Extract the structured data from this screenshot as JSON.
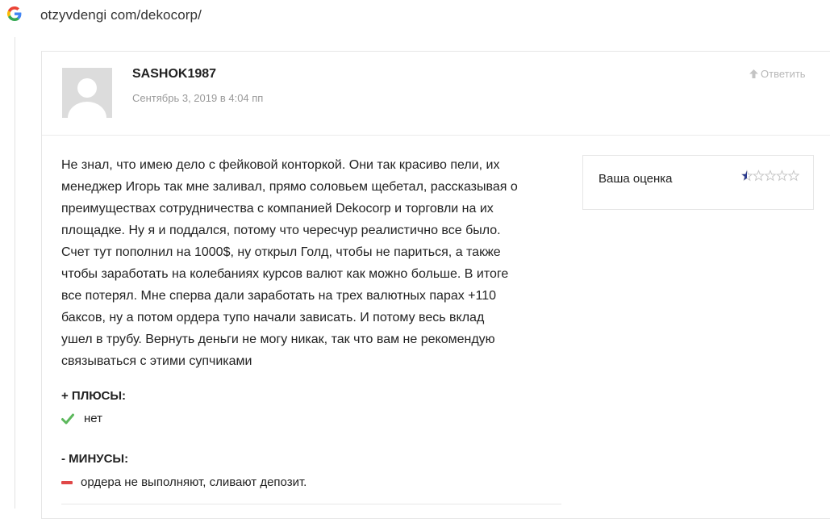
{
  "browser": {
    "url": "otzyvdengi com/dekocorp/",
    "logo_icon": "google-g-icon"
  },
  "comment": {
    "author": "SASHOK1987",
    "date": "Сентябрь 3, 2019 в 4:04 пп",
    "reply_label": "Ответить",
    "reply_icon": "arrow-up-icon",
    "text_lines": [
      "Не знал, что имею дело с фейковой конторкой. Они так красиво пели, их",
      "менеджер Игорь так мне заливал, прямо соловьем щебетал, рассказывая о",
      "преимуществах сотрудничества с компанией Dekocorp и торговли на их",
      "площадке. Ну я и поддался, потому что чересчур реалистично все было.",
      "Счет тут пополнил на 1000$, ну открыл Голд, чтобы не париться, а также",
      "чтобы заработать на колебаниях курсов валют как можно больше. В итоге",
      "все потерял. Мне сперва дали заработать на трех валютных парах +110",
      "баксов, ну а потом ордера тупо начали зависать. И потому весь вклад",
      "ушел в трубу. Вернуть деньги не могу никак, так что вам не рекомендую",
      "связываться с этими супчиками"
    ],
    "rating": {
      "label": "Ваша оценка",
      "value": 0.5,
      "max": 5
    },
    "pros": {
      "title": "+ ПЛЮСЫ:",
      "item": "нет",
      "icon": "check-icon"
    },
    "cons": {
      "title": "- МИНУСЫ:",
      "item": "ордера не выполняют, сливают депозит.",
      "icon": "minus-icon"
    }
  },
  "colors": {
    "check": "#5cb85c",
    "minus": "#e04848",
    "star_fill": "#2a3a8f",
    "star_empty": "#c8c8c8"
  }
}
